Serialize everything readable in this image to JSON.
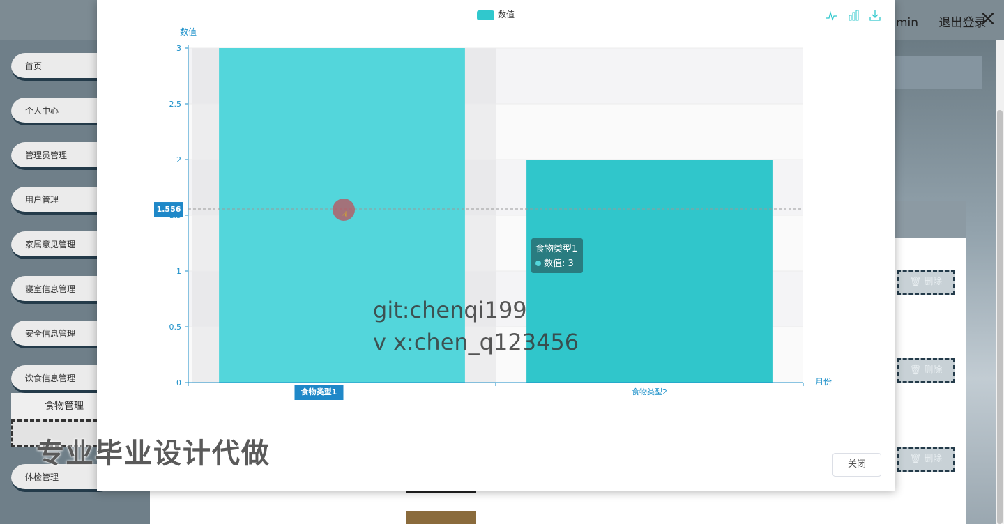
{
  "header": {
    "user_partial": "min",
    "logout_label": "退出登录",
    "close_glyph": "×"
  },
  "sidebar": {
    "items": [
      {
        "label": "首页"
      },
      {
        "label": "个人中心"
      },
      {
        "label": "管理员管理"
      },
      {
        "label": "用户管理"
      },
      {
        "label": "家属意见管理"
      },
      {
        "label": "寝室信息管理"
      },
      {
        "label": "安全信息管理"
      },
      {
        "label": "饮食信息管理"
      },
      {
        "label": "体检管理"
      }
    ],
    "sub_items": [
      {
        "label": "食物管理"
      }
    ]
  },
  "table": {
    "delete_label": "删除"
  },
  "dialog": {
    "legend": {
      "label": "数值",
      "color": "#30c8cd"
    },
    "toolbox": [
      "line-chart-icon",
      "bar-chart-icon",
      "download-icon"
    ],
    "close_label": "关闭",
    "tooltip": {
      "title": "食物类型1",
      "series": "数值",
      "value": "3"
    },
    "pointer_label": "1.556"
  },
  "watermark": {
    "line1": "git:chenqi199",
    "line2": "v x:chen_q123456",
    "line3": "专业毕业设计代做"
  },
  "chart_data": {
    "type": "bar",
    "categories": [
      "食物类型1",
      "食物类型2"
    ],
    "series": [
      {
        "name": "数值",
        "values": [
          3,
          2
        ]
      }
    ],
    "xlabel": "月份",
    "ylabel": "数值",
    "ylim": [
      0,
      3
    ],
    "yticks": [
      "0",
      "0.5",
      "1",
      "1.5",
      "2",
      "2.5",
      "3"
    ],
    "colors": [
      "#53d6db",
      "#30c6cb"
    ],
    "axis_color": "#1a8fc9",
    "grid": "horizontal",
    "legend_position": "top-center"
  }
}
